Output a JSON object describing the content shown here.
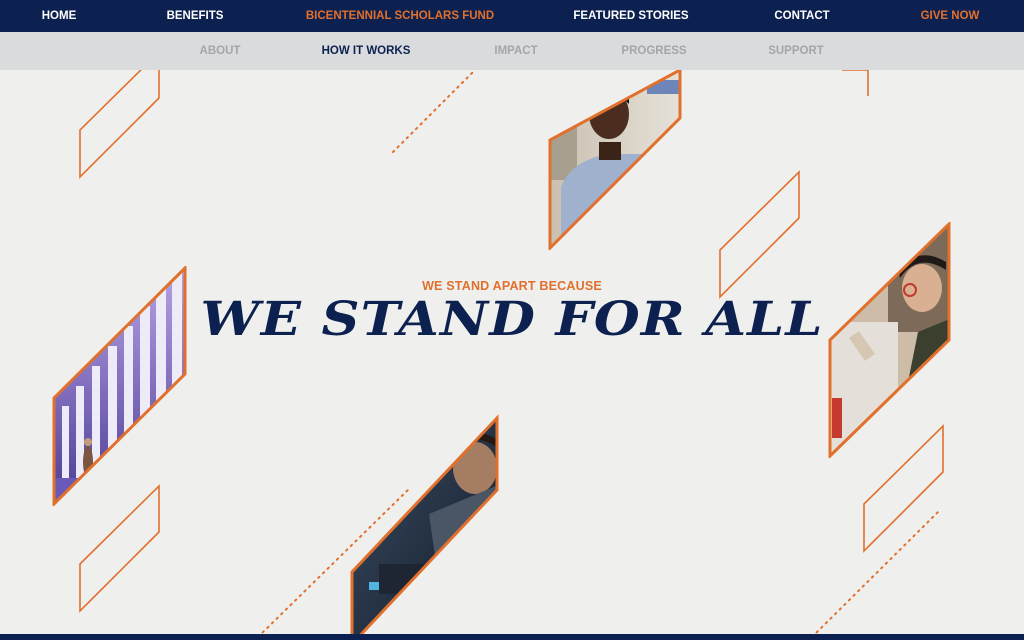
{
  "top_nav": {
    "items": [
      {
        "label": "HOME",
        "accent": false
      },
      {
        "label": "BENEFITS",
        "accent": false
      },
      {
        "label": "BICENTENNIAL SCHOLARS FUND",
        "accent": true
      },
      {
        "label": "FEATURED STORIES",
        "accent": false
      },
      {
        "label": "CONTACT",
        "accent": false
      },
      {
        "label": "GIVE NOW",
        "accent": true
      }
    ]
  },
  "sub_nav": {
    "items": [
      {
        "label": "ABOUT",
        "active": false
      },
      {
        "label": "HOW IT WORKS",
        "active": true
      },
      {
        "label": "IMPACT",
        "active": false
      },
      {
        "label": "PROGRESS",
        "active": false
      },
      {
        "label": "SUPPORT",
        "active": false
      }
    ]
  },
  "hero": {
    "kicker": "WE STAND APART BECAUSE",
    "headline": "WE STAND FOR ALL"
  },
  "photos": [
    {
      "name": "photo-student-portrait"
    },
    {
      "name": "photo-colonnade"
    },
    {
      "name": "photo-student-drawing"
    },
    {
      "name": "photo-student-lab"
    }
  ],
  "colors": {
    "navy": "#0d2150",
    "orange": "#e2702d",
    "background": "#efefed",
    "subnav_bg": "#d9dbdd",
    "subnav_inactive": "#a3a6ab"
  }
}
